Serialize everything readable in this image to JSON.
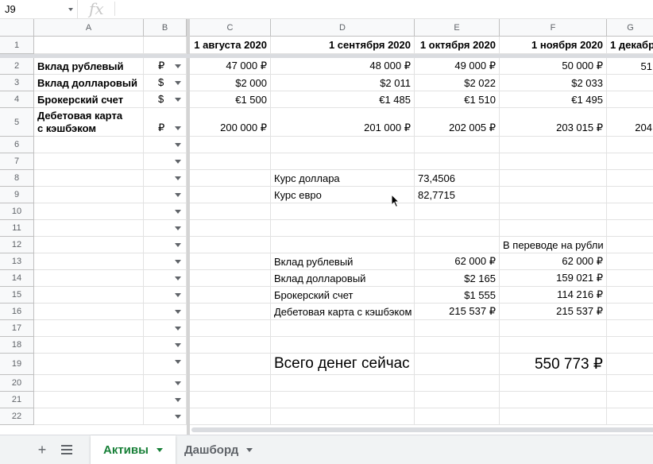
{
  "formula_bar": {
    "cell_ref": "J9",
    "fx_label": "fx",
    "formula": ""
  },
  "columns": [
    "A",
    "B",
    "C",
    "D",
    "E",
    "F",
    "G"
  ],
  "rows": [
    "1",
    "2",
    "3",
    "4",
    "5",
    "6",
    "7",
    "8",
    "9",
    "10",
    "11",
    "12",
    "13",
    "14",
    "15",
    "16",
    "17",
    "18",
    "19",
    "20",
    "21",
    "22"
  ],
  "header_row": {
    "C": "1 августа 2020",
    "D": "1 сентября 2020",
    "E": "1 октября 2020",
    "F": "1 ноября 2020",
    "G": "1 декабр"
  },
  "assets": [
    {
      "name": "Вклад рублевый",
      "currency": "₽",
      "C": "47 000 ₽",
      "D": "48 000 ₽",
      "E": "49 000 ₽",
      "F": "50 000 ₽",
      "G": "51"
    },
    {
      "name": "Вклад долларовый",
      "currency": "$",
      "C": "$2 000",
      "D": "$2 011",
      "E": "$2 022",
      "F": "$2 033",
      "G": ""
    },
    {
      "name": "Брокерский счет",
      "currency": "$",
      "C": "€1 500",
      "D": "€1 485",
      "E": "€1 510",
      "F": "€1 495",
      "G": ""
    },
    {
      "name_line1": "Дебетовая карта",
      "name_line2": "с кэшбэком",
      "currency": "₽",
      "C": "200 000 ₽",
      "D": "201 000 ₽",
      "E": "202 005 ₽",
      "F": "203 015 ₽",
      "G": "204"
    }
  ],
  "rates": [
    {
      "label": "Курс доллара",
      "value": "73,4506"
    },
    {
      "label": "Курс евро",
      "value": "82,7715"
    }
  ],
  "summary": {
    "rub_header": "В переводе на рубли",
    "rows": [
      {
        "label": "Вклад рублевый",
        "value": "62 000 ₽",
        "rub": "62 000 ₽"
      },
      {
        "label": "Вклад долларовый",
        "value": "$2 165",
        "rub": "159 021 ₽"
      },
      {
        "label": "Брокерский счет",
        "value": "$1 555",
        "rub": "114 216 ₽"
      },
      {
        "label": "Дебетовая карта с кэшбэком",
        "value": "215 537 ₽",
        "rub": "215 537 ₽"
      }
    ],
    "total_label": "Всего денег сейчас",
    "total_value": "550 773 ₽"
  },
  "tabs": {
    "add_icon": "plus-icon",
    "list_icon": "list-icon",
    "sheets": [
      {
        "label": "Активы",
        "active": true
      },
      {
        "label": "Дашборд",
        "active": false
      }
    ]
  },
  "colors": {
    "active_tab": "#188038",
    "header_bg": "#f8f9fa",
    "grid": "#e2e2e2"
  }
}
